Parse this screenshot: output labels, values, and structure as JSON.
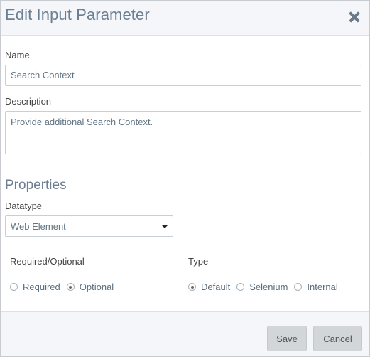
{
  "dialog": {
    "title": "Edit Input Parameter"
  },
  "form": {
    "name_label": "Name",
    "name_value": "Search Context",
    "description_label": "Description",
    "description_value": "Provide additional Search Context."
  },
  "properties": {
    "section_title": "Properties",
    "datatype_label": "Datatype",
    "datatype_selected": "Web Element",
    "required_optional": {
      "label": "Required/Optional",
      "options": [
        {
          "label": "Required",
          "checked": false
        },
        {
          "label": "Optional",
          "checked": true
        }
      ]
    },
    "type": {
      "label": "Type",
      "options": [
        {
          "label": "Default",
          "checked": true
        },
        {
          "label": "Selenium",
          "checked": false
        },
        {
          "label": "Internal",
          "checked": false
        }
      ]
    }
  },
  "footer": {
    "save_label": "Save",
    "cancel_label": "Cancel"
  }
}
